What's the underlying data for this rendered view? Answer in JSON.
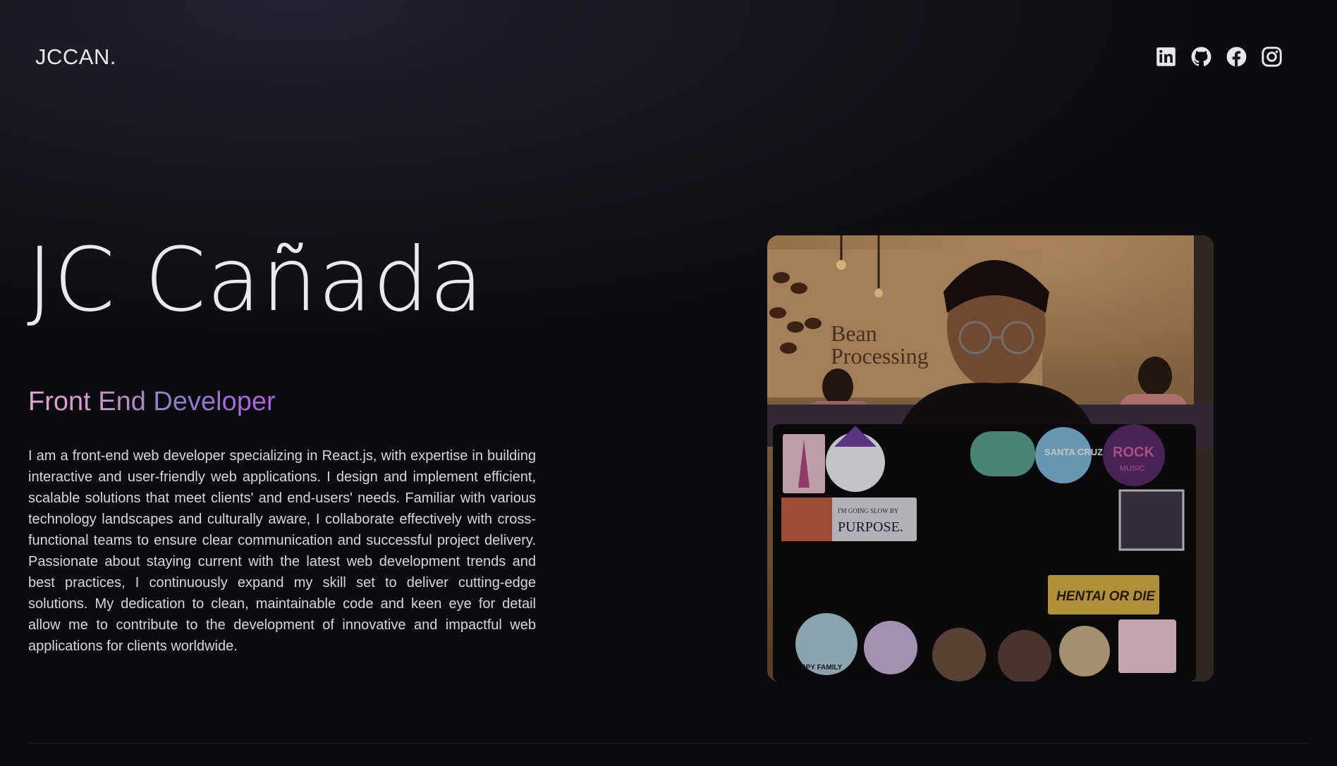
{
  "header": {
    "logo": "JCCAN.",
    "socials": [
      {
        "icon": "linkedin-icon"
      },
      {
        "icon": "github-icon"
      },
      {
        "icon": "facebook-icon"
      },
      {
        "icon": "instagram-icon"
      }
    ]
  },
  "hero": {
    "name": "JC Cañada",
    "role": "Front End Developer",
    "bio": "I am a front-end web developer specializing in React.js, with expertise in building interactive and user-friendly web applications. I design and implement efficient, scalable solutions that meet clients' and end-users' needs. Familiar with various technology landscapes and culturally aware, I collaborate effectively with cross-functional teams to ensure clear communication and successful project delivery. Passionate about staying current with the latest web development trends and best practices, I continuously expand my skill set to deliver cutting-edge solutions. My dedication to clean, maintainable code and keen eye for detail allow me to contribute to the development of innovative and impactful web applications for clients worldwide."
  },
  "portrait": {
    "wall_sign_line1": "Bean",
    "wall_sign_line2": "Processing",
    "sticker_purpose": "PURPOSE.",
    "sticker_purpose_top": "I'M GOING SLOW BY",
    "sticker_santa_cruz": "SANTA CRUZ",
    "sticker_rock": "ROCK",
    "sticker_music": "MUSIC",
    "sticker_hentai": "HENTAI OR DIE",
    "sticker_spy": "SPY FAMILY"
  },
  "colors": {
    "background": "#0c0c10",
    "role_gradient_start": "#e8a5d6",
    "role_gradient_end": "#b060e0"
  }
}
